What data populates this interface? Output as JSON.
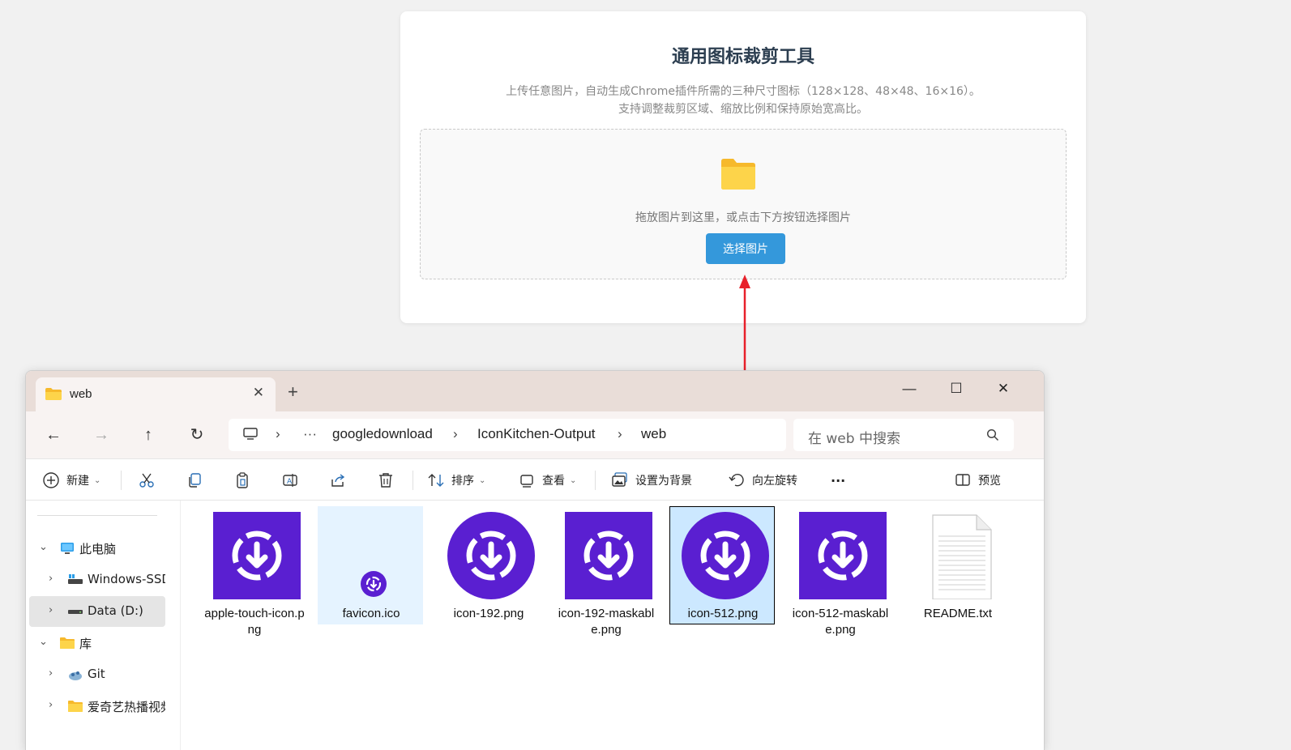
{
  "web": {
    "title": "通用图标裁剪工具",
    "desc_line1": "上传任意图片，自动生成Chrome插件所需的三种尺寸图标（128×128、48×48、16×16）。",
    "desc_line2": "支持调整裁剪区域、缩放比例和保持原始宽高比。",
    "drop_text": "拖放图片到这里，或点击下方按钮选择图片",
    "choose_button": "选择图片",
    "accent_color": "#3498db"
  },
  "explorer": {
    "tab_title": "web",
    "breadcrumb": [
      "googledownload",
      "IconKitchen-Output",
      "web"
    ],
    "search_placeholder": "在 web 中搜索",
    "toolbar": {
      "new": "新建",
      "sort": "排序",
      "view": "查看",
      "set_background": "设置为背景",
      "rotate_left": "向左旋转",
      "more": "···",
      "preview": "预览"
    },
    "sidebar": [
      {
        "label": "此电脑",
        "icon": "monitor-icon"
      },
      {
        "label": "Windows-SSD",
        "icon": "drive-icon"
      },
      {
        "label": "Data (D:)",
        "icon": "drive-icon"
      },
      {
        "label": "库",
        "icon": "library-icon"
      },
      {
        "label": "Git",
        "icon": "git-icon"
      },
      {
        "label": "爱奇艺热播视频",
        "icon": "folder-icon"
      }
    ],
    "files": [
      {
        "name": "apple-touch-icon.png",
        "thumb": "square-icon"
      },
      {
        "name": "favicon.ico",
        "thumb": "small-icon"
      },
      {
        "name": "icon-192.png",
        "thumb": "circle-icon"
      },
      {
        "name": "icon-192-maskable.png",
        "thumb": "square-icon"
      },
      {
        "name": "icon-512.png",
        "thumb": "circle-icon"
      },
      {
        "name": "icon-512-maskable.png",
        "thumb": "square-icon"
      },
      {
        "name": "README.txt",
        "thumb": "text-file-icon"
      }
    ],
    "icon_color": "#5a1fd1"
  }
}
